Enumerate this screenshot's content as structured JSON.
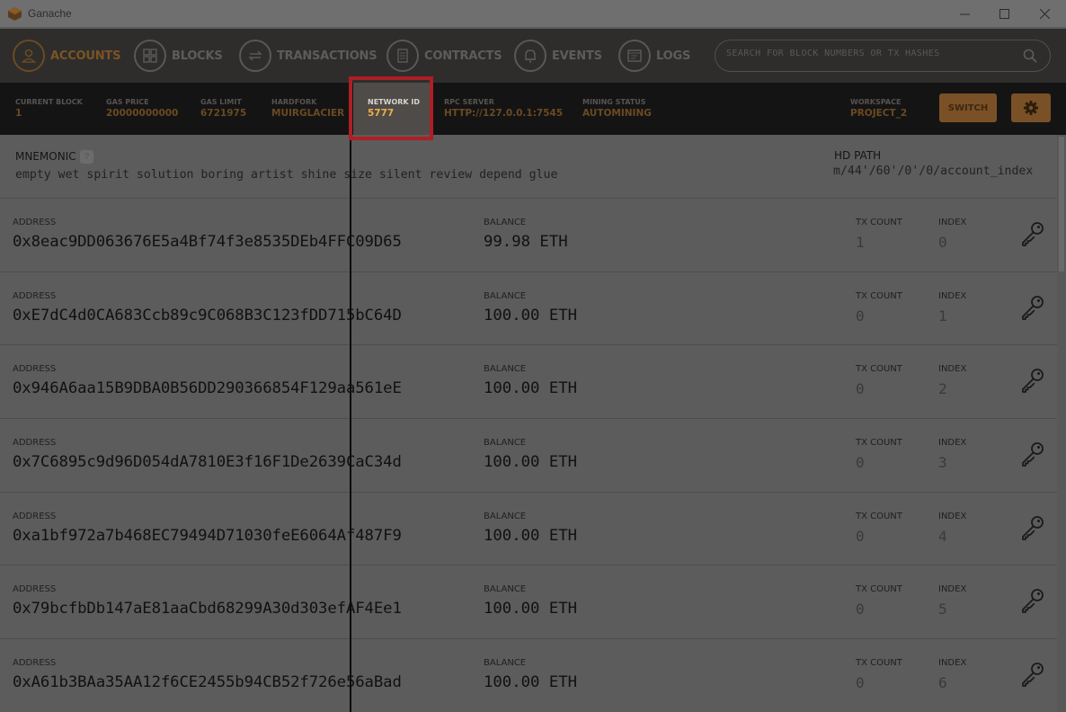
{
  "window": {
    "title": "Ganache"
  },
  "nav": {
    "items": [
      {
        "label": "ACCOUNTS",
        "icon": "user-icon",
        "active": true
      },
      {
        "label": "BLOCKS",
        "icon": "grid-icon"
      },
      {
        "label": "TRANSACTIONS",
        "icon": "arrows-icon"
      },
      {
        "label": "CONTRACTS",
        "icon": "document-icon"
      },
      {
        "label": "EVENTS",
        "icon": "bell-icon"
      },
      {
        "label": "LOGS",
        "icon": "terminal-icon"
      }
    ],
    "search_placeholder": "SEARCH FOR BLOCK NUMBERS OR TX HASHES"
  },
  "stats": {
    "current_block": {
      "label": "CURRENT BLOCK",
      "value": "1"
    },
    "gas_price": {
      "label": "GAS PRICE",
      "value": "20000000000"
    },
    "gas_limit": {
      "label": "GAS LIMIT",
      "value": "6721975"
    },
    "hardfork": {
      "label": "HARDFORK",
      "value": "MUIRGLACIER"
    },
    "network_id": {
      "label": "NETWORK ID",
      "value": "5777"
    },
    "rpc_server": {
      "label": "RPC SERVER",
      "value": "HTTP://127.0.0.1:7545"
    },
    "mining_status": {
      "label": "MINING STATUS",
      "value": "AUTOMINING"
    },
    "workspace": {
      "label": "WORKSPACE",
      "value": "PROJECT_2"
    },
    "switch_label": "SWITCH"
  },
  "mnemonic": {
    "label": "MNEMONIC",
    "help": "?",
    "words": "empty wet spirit solution boring artist shine size silent review depend glue",
    "hd_path_label": "HD PATH",
    "hd_path": "m/44'/60'/0'/0/account_index"
  },
  "headers": {
    "address": "ADDRESS",
    "balance": "BALANCE",
    "tx_count": "TX COUNT",
    "index": "INDEX"
  },
  "accounts": [
    {
      "address": "0x8eac9DD063676E5a4Bf74f3e8535DEb4FFC09D65",
      "balance": "99.98 ETH",
      "tx_count": "1",
      "index": "0"
    },
    {
      "address": "0xE7dC4d0CA683Ccb89c9C068B3C123fDD715bC64D",
      "balance": "100.00 ETH",
      "tx_count": "0",
      "index": "1"
    },
    {
      "address": "0x946A6aa15B9DBA0B56DD290366854F129aa561eE",
      "balance": "100.00 ETH",
      "tx_count": "0",
      "index": "2"
    },
    {
      "address": "0x7C6895c9d96D054dA7810E3f16F1De2639CaC34d",
      "balance": "100.00 ETH",
      "tx_count": "0",
      "index": "3"
    },
    {
      "address": "0xa1bf972a7b468EC79494D71030feE6064Af487F9",
      "balance": "100.00 ETH",
      "tx_count": "0",
      "index": "4"
    },
    {
      "address": "0x79bcfbDb147aE81aaCbd68299A30d303efAF4Ee1",
      "balance": "100.00 ETH",
      "tx_count": "0",
      "index": "5"
    },
    {
      "address": "0xA61b3BAa35AA12f6CE2455b94CB52f726e56aBad",
      "balance": "100.00 ETH",
      "tx_count": "0",
      "index": "6"
    }
  ],
  "colors": {
    "accent": "#f0ac4a",
    "highlight_box": "#ae1e25",
    "overlay_bg": "#5c5c5c"
  }
}
